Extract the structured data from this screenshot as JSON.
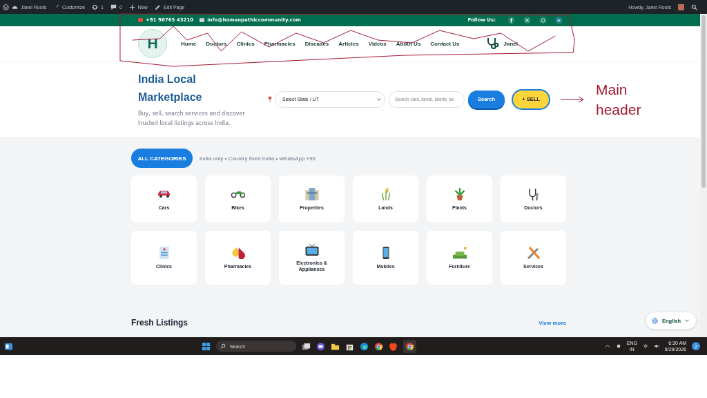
{
  "admin_bar": {
    "items": [
      "Janel Roots",
      "Customize",
      "1",
      "0",
      "New",
      "Edit Page"
    ],
    "greeting": "Howdy, Janel Roots"
  },
  "top_bar": {
    "phone": "+91 98765 43210",
    "email": "info@homeopathiccommunity.com",
    "follow_label": "Follow Us:"
  },
  "nav": {
    "logo": "H",
    "items": [
      "Home",
      "Doctors",
      "Clinics",
      "Pharmacies",
      "Diseases",
      "Articles",
      "Videos",
      "About Us",
      "Contact Us"
    ],
    "user": "Janel"
  },
  "hero": {
    "title": "India Local Marketplace",
    "subtitle": "Buy, sell, search services and discover trusted local listings across India.",
    "state_select": "Select State / UT",
    "search_placeholder": "Search cars, lands, plants, se",
    "search_button": "Search",
    "sell_button": "+ SELL"
  },
  "annotation": {
    "text": "Main header"
  },
  "categories": {
    "button": "ALL CATEGORIES",
    "note": "India only • Country fixed India • WhatsApp +91",
    "items": [
      "Cars",
      "Bikes",
      "Properties",
      "Lands",
      "Plants",
      "Doctors",
      "Clinics",
      "Pharmacies",
      "Electronics & Appliances",
      "Mobiles",
      "Furniture",
      "Services"
    ]
  },
  "fresh_listings": {
    "title": "Fresh Listings",
    "link": "View more"
  },
  "language": {
    "label": "English"
  },
  "taskbar": {
    "search": "Search",
    "lang": "ENG",
    "region": "IN",
    "time": "6:30 AM",
    "date": "6/29/2026",
    "notifications": "2"
  }
}
